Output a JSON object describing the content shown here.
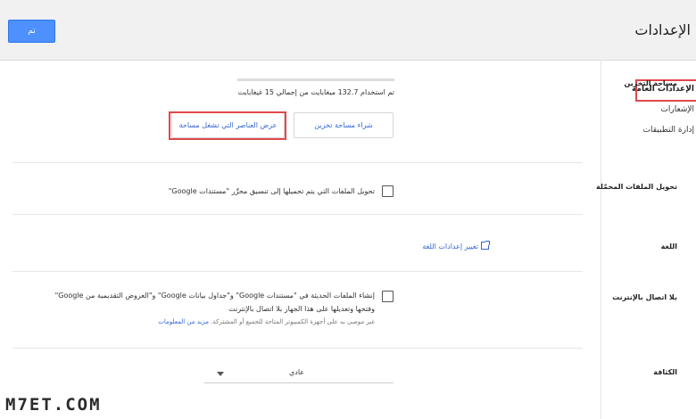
{
  "header": {
    "title": "الإعدادات",
    "done_label": "تم"
  },
  "sidebar": {
    "items": [
      {
        "label": "الإعدادات العامة",
        "active": true
      },
      {
        "label": "الإشعارات",
        "active": false
      },
      {
        "label": "إدارة التطبيقات",
        "active": false
      }
    ]
  },
  "storage": {
    "label": "مساحة التخزين",
    "usage_text": "تم استخدام 132.7 ميغابايت من إجمالي 15 غيغابايت",
    "buy_button": "شراء مساحة تخزين",
    "view_items_button": "عرض العناصر التي تشغل مساحة"
  },
  "convert": {
    "label": "تحويل الملفات المحمّلة",
    "checkbox_text": "تحويل الملفات التي يتم تحميلها إلى تنسيق محرِّر \"مستندات Google\""
  },
  "language": {
    "label": "اللغة",
    "link_text": "تغيير إعدادات اللغة"
  },
  "offline": {
    "label": "بلا اتصال بالإنترنت",
    "line1": "إنشاء الملفات الحديثة في \"مستندات Google\" و\"جداول بيانات Google\" و\"العروض التقديمية من Google\"",
    "line2": "وفتحها وتعديلها على هذا الجهاز بلا اتصال بالإنترنت",
    "note": "غير موصى به على أجهزة الكمبيوتر المتاحة للجميع أو المشتركة.",
    "more_info": "مزيد من المعلومات"
  },
  "density": {
    "label": "الكثافة",
    "selected": "عادي"
  },
  "watermark": "M7ET.COM",
  "colors": {
    "accent": "#4d90fe",
    "link": "#3367d6",
    "highlight": "#e2484b"
  }
}
